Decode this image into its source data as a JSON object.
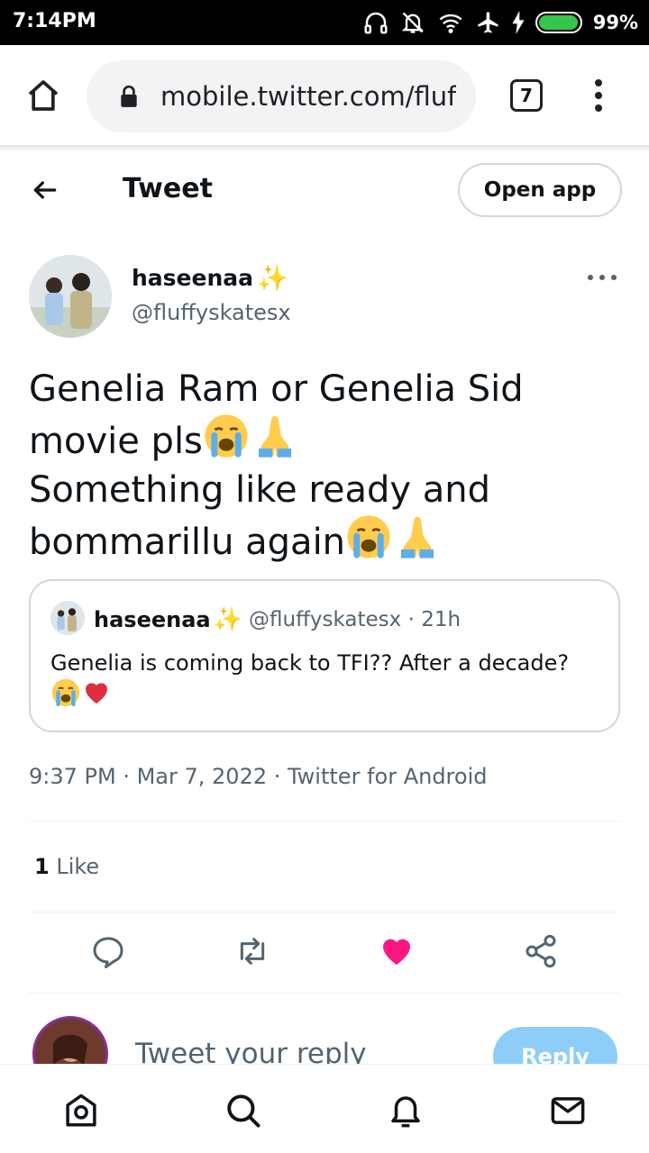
{
  "status_bar": {
    "time": "7:14PM",
    "battery_percent": "99%",
    "battery_level": 0.99,
    "icons": [
      "headphones-icon",
      "bell-off-icon",
      "wifi-icon",
      "airplane-icon",
      "charging-icon",
      "battery-icon"
    ]
  },
  "browser": {
    "url": "mobile.twitter.com/fluf",
    "tab_count": "7",
    "icons": [
      "home-icon",
      "lock-icon",
      "tabs-icon",
      "menu-icon"
    ]
  },
  "header": {
    "title": "Tweet",
    "open_app_label": "Open app"
  },
  "tweet": {
    "author_name": "haseenaa",
    "author_emoji": "✨",
    "author_handle": "@fluffyskatesx",
    "text_line1": "Genelia Ram or Genelia Sid",
    "text_line2": "movie pls",
    "text_line3": "Something like ready and",
    "text_line4": "bommarillu again",
    "timestamp": "9:37 PM · Mar 7, 2022 · Twitter for Android",
    "like_count": "1",
    "like_label": "Like"
  },
  "quoted_tweet": {
    "author_name": "haseenaa",
    "author_emoji": "✨",
    "meta": "@fluffyskatesx · 21h",
    "text": "Genelia is coming back to TFI?? After a decade?"
  },
  "actions": [
    "reply-icon",
    "retweet-icon",
    "like-icon",
    "share-icon"
  ],
  "reply": {
    "placeholder": "Tweet your reply",
    "button_label": "Reply"
  },
  "bottom_nav": [
    "home-nav-icon",
    "search-nav-icon",
    "notifications-nav-icon",
    "messages-nav-icon"
  ],
  "colors": {
    "like_active": "#f91880",
    "reply_button": "#8ecdf8",
    "secondary_text": "#536471"
  }
}
